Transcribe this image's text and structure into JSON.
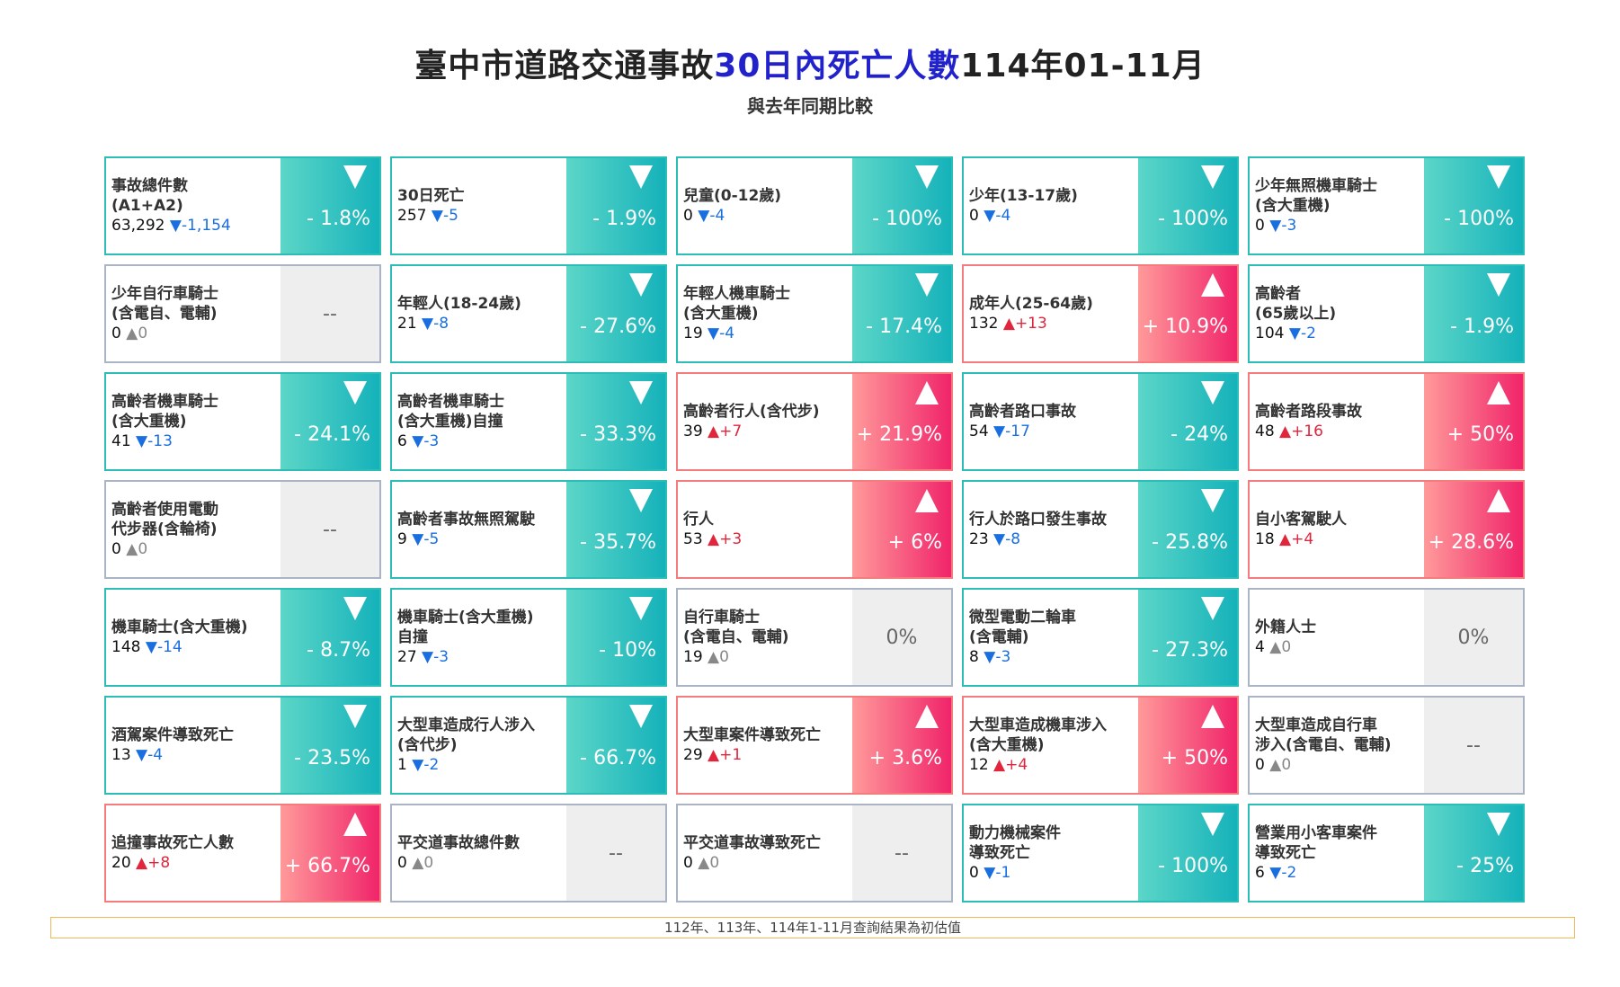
{
  "header": {
    "title_part1": "臺中市道路交通事故",
    "title_highlight": "30日內死亡人數",
    "title_part2": "114年01-11月",
    "subtitle": "與去年同期比較"
  },
  "footnote": "112年、113年、114年1-11月查詢結果為初估值",
  "colors": {
    "down_start": "#5cd6c8",
    "down_end": "#15b2ba",
    "up_start": "#ff9a9a",
    "up_end": "#f0246a",
    "flat": "#eeeeee",
    "highlight": "#2222cc"
  },
  "cards": [
    {
      "name": "事故總件數\n(A1+A2)",
      "value": "63,292",
      "trend": "down",
      "change": "-1,154",
      "pct": "- 1.8%"
    },
    {
      "name": "30日死亡",
      "value": "257",
      "trend": "down",
      "change": "-5",
      "pct": "- 1.9%"
    },
    {
      "name": "兒童(0-12歲)",
      "value": "0",
      "trend": "down",
      "change": "-4",
      "pct": "- 100%"
    },
    {
      "name": "少年(13-17歲)",
      "value": "0",
      "trend": "down",
      "change": "-4",
      "pct": "- 100%"
    },
    {
      "name": "少年無照機車騎士\n(含大重機)",
      "value": "0",
      "trend": "down",
      "change": "-3",
      "pct": "- 100%"
    },
    {
      "name": "少年自行車騎士\n(含電自、電輔)",
      "value": "0",
      "trend": "flat",
      "change": "0",
      "pct": "--"
    },
    {
      "name": "年輕人(18-24歲)",
      "value": "21",
      "trend": "down",
      "change": "-8",
      "pct": "- 27.6%"
    },
    {
      "name": "年輕人機車騎士\n(含大重機)",
      "value": "19",
      "trend": "down",
      "change": "-4",
      "pct": "- 17.4%"
    },
    {
      "name": "成年人(25-64歲)",
      "value": "132",
      "trend": "up",
      "change": "+13",
      "pct": "+ 10.9%"
    },
    {
      "name": "高齡者\n(65歲以上)",
      "value": "104",
      "trend": "down",
      "change": "-2",
      "pct": "- 1.9%"
    },
    {
      "name": "高齡者機車騎士\n(含大重機)",
      "value": "41",
      "trend": "down",
      "change": "-13",
      "pct": "- 24.1%"
    },
    {
      "name": "高齡者機車騎士\n(含大重機)自撞",
      "value": "6",
      "trend": "down",
      "change": "-3",
      "pct": "- 33.3%"
    },
    {
      "name": "高齡者行人(含代步)",
      "value": "39",
      "trend": "up",
      "change": "+7",
      "pct": "+ 21.9%"
    },
    {
      "name": "高齡者路口事故",
      "value": "54",
      "trend": "down",
      "change": "-17",
      "pct": "- 24%"
    },
    {
      "name": "高齡者路段事故",
      "value": "48",
      "trend": "up",
      "change": "+16",
      "pct": "+ 50%"
    },
    {
      "name": "高齡者使用電動\n代步器(含輪椅)",
      "value": "0",
      "trend": "flat",
      "change": "0",
      "pct": "--"
    },
    {
      "name": "高齡者事故無照駕駛",
      "value": "9",
      "trend": "down",
      "change": "-5",
      "pct": "- 35.7%"
    },
    {
      "name": "行人",
      "value": "53",
      "trend": "up",
      "change": "+3",
      "pct": "+ 6%"
    },
    {
      "name": "行人於路口發生事故",
      "value": "23",
      "trend": "down",
      "change": "-8",
      "pct": "- 25.8%"
    },
    {
      "name": "自小客駕駛人",
      "value": "18",
      "trend": "up",
      "change": "+4",
      "pct": "+ 28.6%"
    },
    {
      "name": "機車騎士(含大重機)",
      "value": "148",
      "trend": "down",
      "change": "-14",
      "pct": "- 8.7%"
    },
    {
      "name": "機車騎士(含大重機)\n自撞",
      "value": "27",
      "trend": "down",
      "change": "-3",
      "pct": "- 10%"
    },
    {
      "name": "自行車騎士\n(含電自、電輔)",
      "value": "19",
      "trend": "flat",
      "change": "0",
      "pct": "0%"
    },
    {
      "name": "微型電動二輪車\n(含電輔)",
      "value": "8",
      "trend": "down",
      "change": "-3",
      "pct": "- 27.3%"
    },
    {
      "name": "外籍人士",
      "value": "4",
      "trend": "flat",
      "change": "0",
      "pct": "0%"
    },
    {
      "name": "酒駕案件導致死亡",
      "value": "13",
      "trend": "down",
      "change": "-4",
      "pct": "- 23.5%"
    },
    {
      "name": "大型車造成行人涉入\n(含代步)",
      "value": "1",
      "trend": "down",
      "change": "-2",
      "pct": "- 66.7%"
    },
    {
      "name": "大型車案件導致死亡",
      "value": "29",
      "trend": "up",
      "change": "+1",
      "pct": "+ 3.6%"
    },
    {
      "name": "大型車造成機車涉入\n(含大重機)",
      "value": "12",
      "trend": "up",
      "change": "+4",
      "pct": "+ 50%"
    },
    {
      "name": "大型車造成自行車\n涉入(含電自、電輔)",
      "value": "0",
      "trend": "flat",
      "change": "0",
      "pct": "--"
    },
    {
      "name": "追撞事故死亡人數",
      "value": "20",
      "trend": "up",
      "change": "+8",
      "pct": "+ 66.7%"
    },
    {
      "name": "平交道事故總件數",
      "value": "0",
      "trend": "flat",
      "change": "0",
      "pct": "--"
    },
    {
      "name": "平交道事故導致死亡",
      "value": "0",
      "trend": "flat",
      "change": "0",
      "pct": "--"
    },
    {
      "name": "動力機械案件\n導致死亡",
      "value": "0",
      "trend": "down",
      "change": "-1",
      "pct": "- 100%"
    },
    {
      "name": "營業用小客車案件\n導致死亡",
      "value": "6",
      "trend": "down",
      "change": "-2",
      "pct": "- 25%"
    }
  ]
}
